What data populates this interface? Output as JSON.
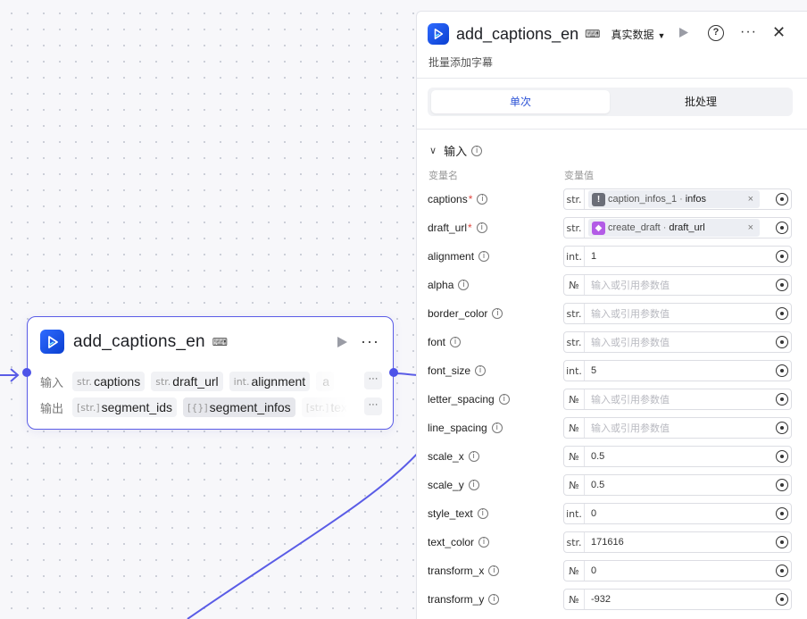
{
  "node": {
    "title": "add_captions_en",
    "mode_icon": "test-mode-icon",
    "input_label": "输入",
    "output_label": "输出",
    "inputs": [
      {
        "type": "str.",
        "name": "captions"
      },
      {
        "type": "str.",
        "name": "draft_url"
      },
      {
        "type": "int.",
        "name": "alignment"
      },
      {
        "type": "",
        "name": "a"
      }
    ],
    "outputs": [
      {
        "type": "[str.]",
        "name": "segment_ids"
      },
      {
        "type": "[{}]",
        "name": "segment_infos"
      },
      {
        "type": "[str.]",
        "name": "text"
      }
    ],
    "more": "···"
  },
  "panel": {
    "title": "add_captions_en",
    "data_mode": "真实数据",
    "subtitle": "批量添加字幕",
    "tabs": [
      "单次",
      "批处理"
    ],
    "section_title": "输入",
    "col_name": "变量名",
    "col_value": "变量值",
    "params": [
      {
        "name": "captions",
        "required": true,
        "type": "str.",
        "ref": {
          "node": "caption_infos_1",
          "field": "infos",
          "icon": "grey"
        }
      },
      {
        "name": "draft_url",
        "required": true,
        "type": "str.",
        "ref": {
          "node": "create_draft",
          "field": "draft_url",
          "icon": "purple"
        }
      },
      {
        "name": "alignment",
        "type": "int.",
        "value": "1"
      },
      {
        "name": "alpha",
        "type": "№",
        "placeholder": "输入或引用参数值"
      },
      {
        "name": "border_color",
        "type": "str.",
        "placeholder": "输入或引用参数值"
      },
      {
        "name": "font",
        "type": "str.",
        "placeholder": "输入或引用参数值"
      },
      {
        "name": "font_size",
        "type": "int.",
        "value": "5"
      },
      {
        "name": "letter_spacing",
        "type": "№",
        "placeholder": "输入或引用参数值"
      },
      {
        "name": "line_spacing",
        "type": "№",
        "placeholder": "输入或引用参数值"
      },
      {
        "name": "scale_x",
        "type": "№",
        "value": "0.5"
      },
      {
        "name": "scale_y",
        "type": "№",
        "value": "0.5"
      },
      {
        "name": "style_text",
        "type": "int.",
        "value": "0"
      },
      {
        "name": "text_color",
        "type": "str.",
        "value": "171616"
      },
      {
        "name": "transform_x",
        "type": "№",
        "value": "0"
      },
      {
        "name": "transform_y",
        "type": "№",
        "value": "-932"
      }
    ]
  },
  "colors": {
    "accent": "#4d53e8",
    "tab_active": "#2b52d6",
    "required": "#e0463f"
  }
}
